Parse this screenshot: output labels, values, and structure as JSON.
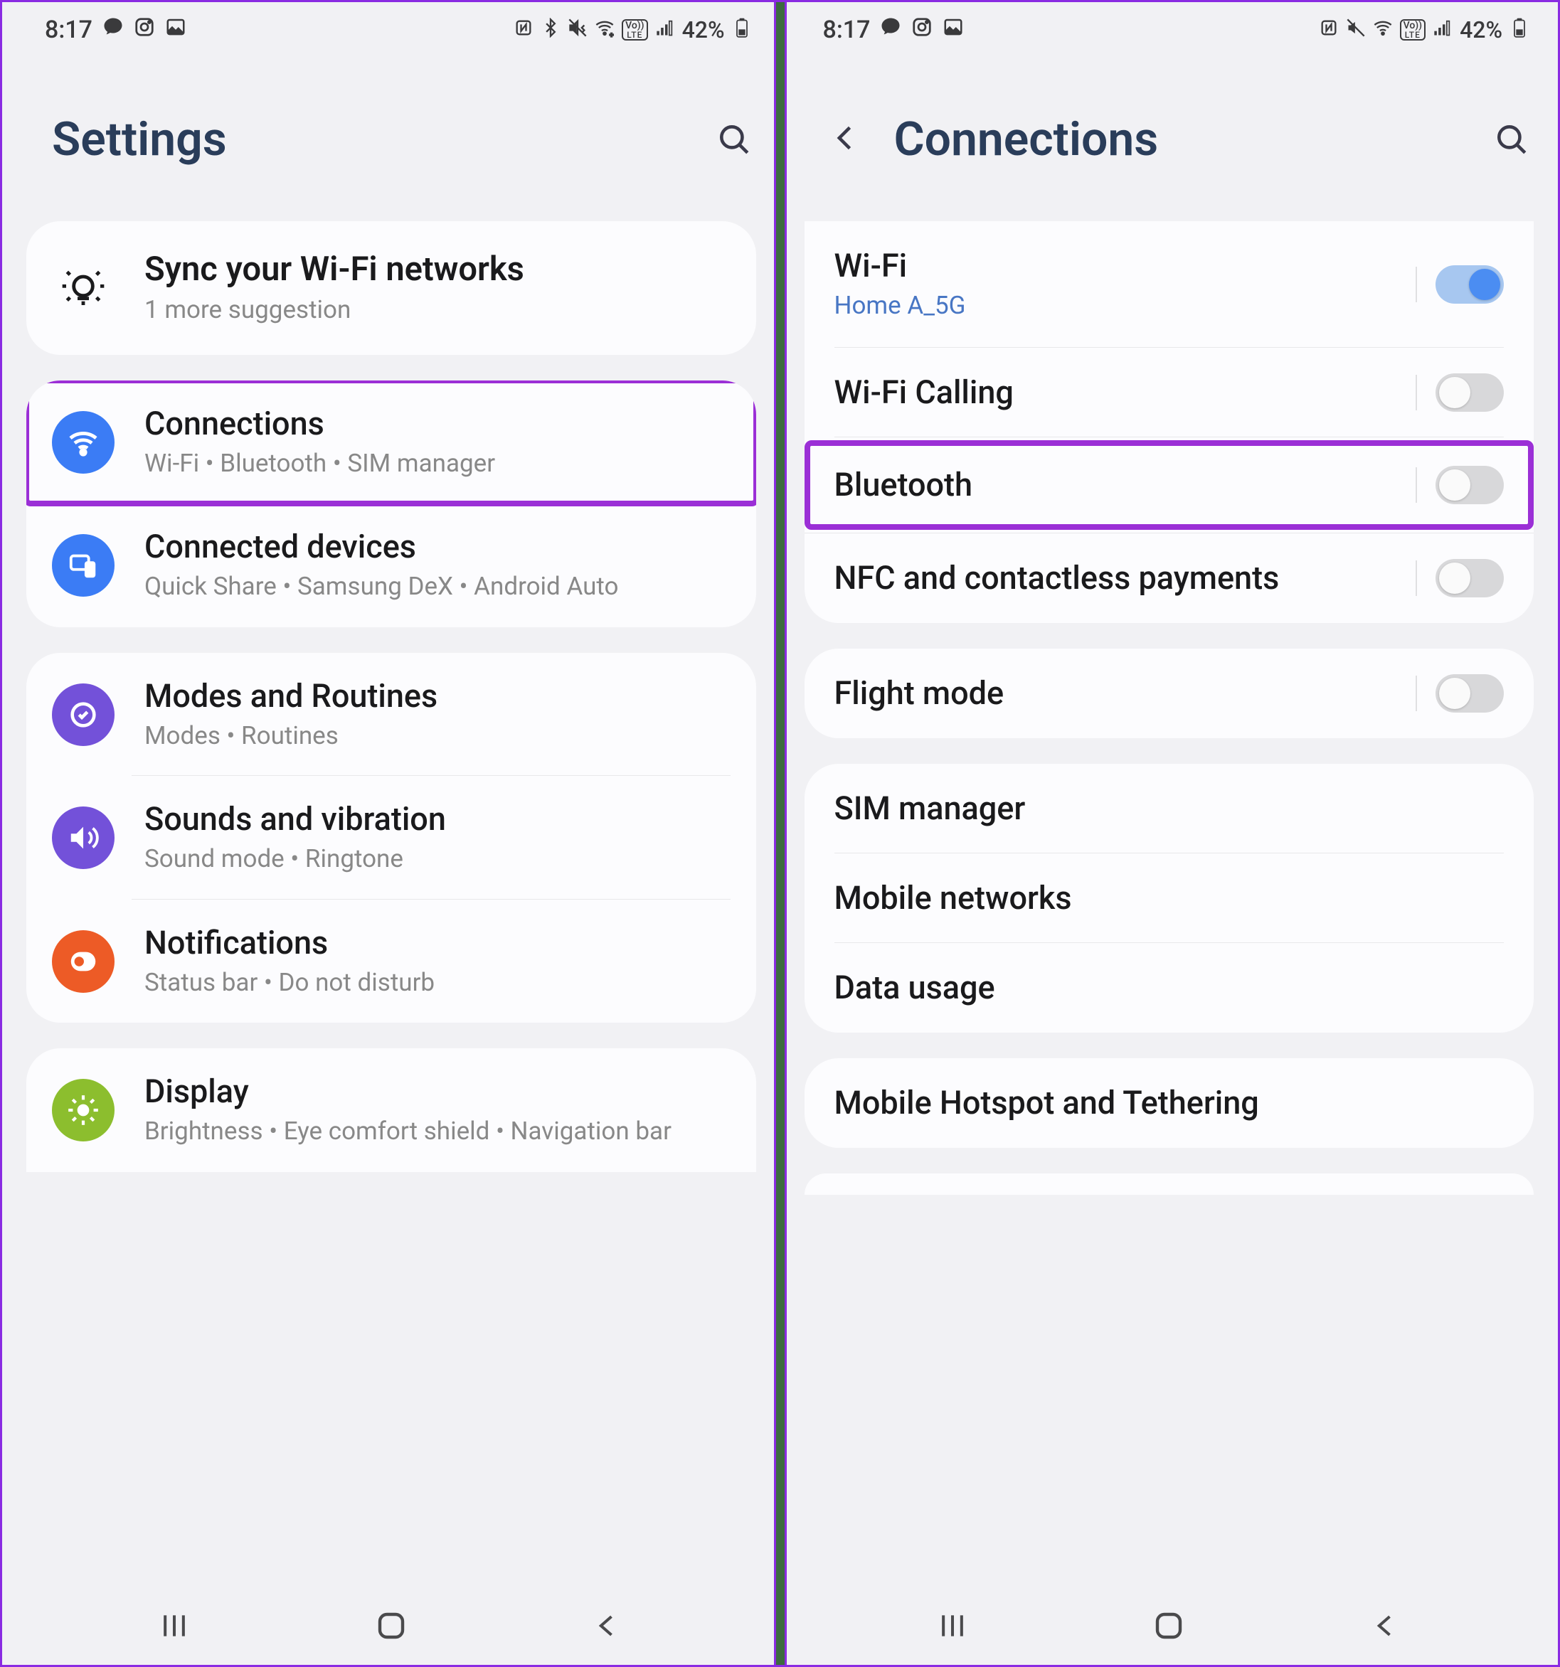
{
  "left": {
    "status": {
      "time": "8:17",
      "battery_pct": "42%"
    },
    "header": {
      "title": "Settings"
    },
    "sync_card": {
      "title": "Sync your Wi-Fi networks",
      "sub": "1 more suggestion"
    },
    "items": [
      {
        "title": "Connections",
        "sub": "Wi-Fi  •  Bluetooth  •  SIM manager",
        "highlight": true
      },
      {
        "title": "Connected devices",
        "sub": "Quick Share  •  Samsung DeX  •  Android Auto"
      },
      {
        "title": "Modes and Routines",
        "sub": "Modes  •  Routines"
      },
      {
        "title": "Sounds and vibration",
        "sub": "Sound mode  •  Ringtone"
      },
      {
        "title": "Notifications",
        "sub": "Status bar  •  Do not disturb"
      },
      {
        "title": "Display",
        "sub": "Brightness  •  Eye comfort shield  •  Navigation bar"
      }
    ]
  },
  "right": {
    "status": {
      "time": "8:17",
      "battery_pct": "42%"
    },
    "header": {
      "title": "Connections"
    },
    "wifi": {
      "title": "Wi-Fi",
      "network": "Home A_5G"
    },
    "wifi_calling": {
      "title": "Wi-Fi Calling"
    },
    "bluetooth": {
      "title": "Bluetooth"
    },
    "nfc": {
      "title": "NFC and contactless payments"
    },
    "flight": {
      "title": "Flight mode"
    },
    "sim": {
      "title": "SIM manager"
    },
    "mobile_net": {
      "title": "Mobile networks"
    },
    "data": {
      "title": "Data usage"
    },
    "hotspot": {
      "title": "Mobile Hotspot and Tethering"
    }
  }
}
